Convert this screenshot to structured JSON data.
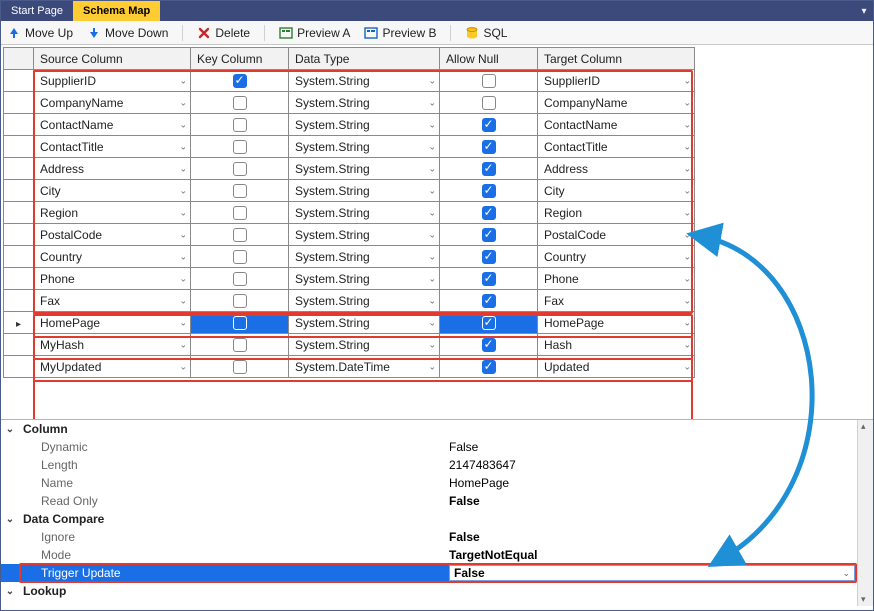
{
  "tabs": {
    "start": "Start Page",
    "schema": "Schema Map"
  },
  "toolbar": {
    "moveUp": "Move Up",
    "moveDown": "Move Down",
    "delete": "Delete",
    "previewA": "Preview A",
    "previewB": "Preview B",
    "sql": "SQL"
  },
  "grid": {
    "headers": {
      "src": "Source Column",
      "key": "Key Column",
      "type": "Data Type",
      "null": "Allow Null",
      "tgt": "Target Column"
    },
    "rows": [
      {
        "src": "SupplierID",
        "key": true,
        "type": "System.String",
        "null": false,
        "tgt": "SupplierID",
        "current": false
      },
      {
        "src": "CompanyName",
        "key": false,
        "type": "System.String",
        "null": false,
        "tgt": "CompanyName",
        "current": false
      },
      {
        "src": "ContactName",
        "key": false,
        "type": "System.String",
        "null": true,
        "tgt": "ContactName",
        "current": false
      },
      {
        "src": "ContactTitle",
        "key": false,
        "type": "System.String",
        "null": true,
        "tgt": "ContactTitle",
        "current": false
      },
      {
        "src": "Address",
        "key": false,
        "type": "System.String",
        "null": true,
        "tgt": "Address",
        "current": false
      },
      {
        "src": "City",
        "key": false,
        "type": "System.String",
        "null": true,
        "tgt": "City",
        "current": false
      },
      {
        "src": "Region",
        "key": false,
        "type": "System.String",
        "null": true,
        "tgt": "Region",
        "current": false
      },
      {
        "src": "PostalCode",
        "key": false,
        "type": "System.String",
        "null": true,
        "tgt": "PostalCode",
        "current": false
      },
      {
        "src": "Country",
        "key": false,
        "type": "System.String",
        "null": true,
        "tgt": "Country",
        "current": false
      },
      {
        "src": "Phone",
        "key": false,
        "type": "System.String",
        "null": true,
        "tgt": "Phone",
        "current": false
      },
      {
        "src": "Fax",
        "key": false,
        "type": "System.String",
        "null": true,
        "tgt": "Fax",
        "current": false
      },
      {
        "src": "HomePage",
        "key": false,
        "type": "System.String",
        "null": true,
        "tgt": "HomePage",
        "current": true
      },
      {
        "src": "MyHash",
        "key": false,
        "type": "System.String",
        "null": true,
        "tgt": "Hash",
        "current": false
      },
      {
        "src": "MyUpdated",
        "key": false,
        "type": "System.DateTime",
        "null": true,
        "tgt": "Updated",
        "current": false
      }
    ]
  },
  "props": {
    "catColumn": "Column",
    "dynamic_l": "Dynamic",
    "dynamic_v": "False",
    "length_l": "Length",
    "length_v": "2147483647",
    "name_l": "Name",
    "name_v": "HomePage",
    "readonly_l": "Read Only",
    "readonly_v": "False",
    "catCompare": "Data Compare",
    "ignore_l": "Ignore",
    "ignore_v": "False",
    "mode_l": "Mode",
    "mode_v": "TargetNotEqual",
    "trigger_l": "Trigger Update",
    "trigger_v": "False",
    "catLookup": "Lookup"
  }
}
